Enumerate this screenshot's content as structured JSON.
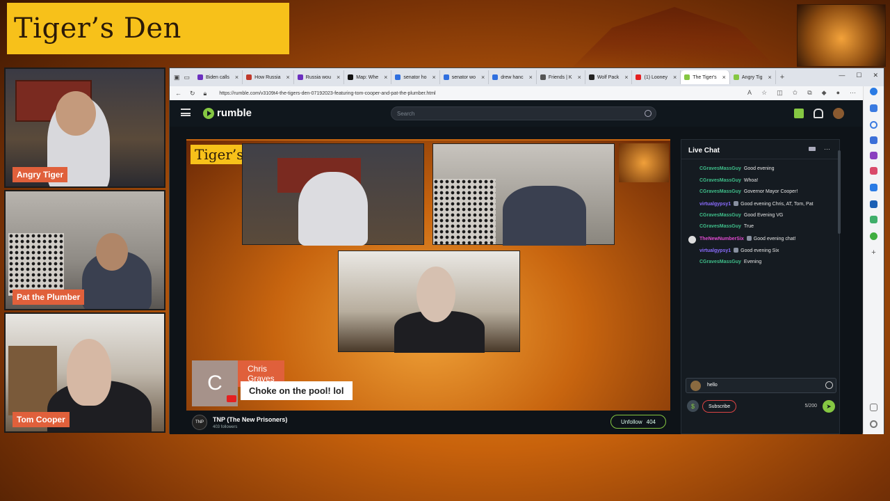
{
  "overlay": {
    "banner_title": "Tiger’s Den",
    "cams": [
      {
        "label": "Angry Tiger"
      },
      {
        "label": "Pat the Plumber"
      },
      {
        "label": "Tom Cooper"
      }
    ]
  },
  "browser": {
    "tabs": [
      {
        "label": "Biden calls",
        "color": "#6b2fbf"
      },
      {
        "label": "How Russia",
        "color": "#c0392b"
      },
      {
        "label": "Russia wou",
        "color": "#6b2fbf"
      },
      {
        "label": "Map: Whe",
        "color": "#111111"
      },
      {
        "label": "senator ho",
        "color": "#2f6fdf"
      },
      {
        "label": "senator wo",
        "color": "#2f6fdf"
      },
      {
        "label": "drew hanc",
        "color": "#2f6fdf"
      },
      {
        "label": "Friends | K",
        "color": "#555555"
      },
      {
        "label": "Wolf Pack",
        "color": "#222222"
      },
      {
        "label": "(1) Looney",
        "color": "#e52020"
      },
      {
        "label": "The Tiger's",
        "color": "#85c742",
        "active": true
      },
      {
        "label": "Angry Tig",
        "color": "#85c742"
      }
    ],
    "url": "https://rumble.com/v3109t4-the-tigers-den-07192023-featuring-tom-cooper-and-pat-the-plumber.html"
  },
  "rumble": {
    "logo": "rumble",
    "search_placeholder": "Search",
    "video_title_overlay": "Tiger’s",
    "chat_popup": {
      "avatar_letter": "C",
      "name": "Chris Graves",
      "message": "Choke on the pool! lol"
    },
    "channel": {
      "logo": "TNP",
      "name": "TNP (The New Prisoners)",
      "followers": "403 followers",
      "unfollow_label": "Unfollow",
      "unfollow_count": "404"
    }
  },
  "chat": {
    "title": "Live Chat",
    "messages": [
      {
        "user": "CGravesMassGuy",
        "text": "Good evening",
        "color": "#3fbf8a"
      },
      {
        "user": "CGravesMassGuy",
        "text": "Whoa!",
        "color": "#3fbf8a"
      },
      {
        "user": "CGravesMassGuy",
        "text": "Governor Mayor Cooper!",
        "color": "#3fbf8a"
      },
      {
        "user": "virtualgypsy1",
        "text": "Good evening Chris, AT, Tom, Pat",
        "color": "#8b6cff"
      },
      {
        "user": "CGravesMassGuy",
        "text": "Good Evening VG",
        "color": "#3fbf8a"
      },
      {
        "user": "CGravesMassGuy",
        "text": "True",
        "color": "#3fbf8a"
      },
      {
        "user": "TheNewNumberSix",
        "text": "Good evening chat!",
        "color": "#e04ad0"
      },
      {
        "user": "virtualgypsy1",
        "text": "Good evening Six",
        "color": "#8b6cff"
      },
      {
        "user": "CGravesMassGuy",
        "text": "Evening",
        "color": "#3fbf8a"
      }
    ],
    "input_value": "hello",
    "subscribe_label": "Subscribe",
    "char_count": "5/200"
  }
}
